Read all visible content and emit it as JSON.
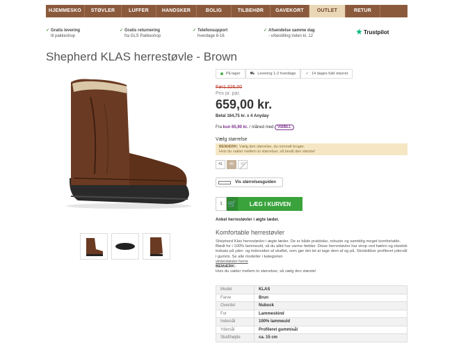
{
  "nav": [
    "HJEMMESKO",
    "STØVLER",
    "LUFFER",
    "HANDSKER",
    "BOLIG",
    "TILBEHØR",
    "GAVEKORT",
    "OUTLET",
    "RETUR"
  ],
  "nav_active": "OUTLET",
  "usps": [
    {
      "title": "Gratis levering",
      "sub": "til pakkeshop"
    },
    {
      "title": "Gratis returnering",
      "sub": "fra GLS Pakkeshop"
    },
    {
      "title": "Telefonsupport",
      "sub": "hverdage 8-16"
    },
    {
      "title": "Afsendelse samme dag",
      "sub": "- v/bestilling inden kl. 12"
    }
  ],
  "trustpilot": "Trustpilot",
  "product": {
    "title": "Shepherd KLAS herrestøvle - Brown",
    "badges": [
      "På lager",
      "Levering 1-2 hverdage",
      "14 dages fuld returret"
    ],
    "old_price": "Før1.325,00",
    "per_pair": "Pris pr. par.",
    "price": "659,00 kr.",
    "anyday_text": "Betal 164,75 kr. x 4",
    "anyday_brand": "Anyday",
    "viabill_pre": "Fra",
    "viabill_amount": "kun 65,90 kr.",
    "viabill_post": "/ måned med",
    "viabill_brand": "VIABILL",
    "choose_size": "Vælg størrelse",
    "note_title": "BEMÆRK:",
    "note_text": "Vælg den størrelse, du normalt bruger.",
    "note_text2": "Hvis du vakler mellem to størrelser, så bestil den største!",
    "sizes": [
      {
        "label": "41",
        "state": "normal"
      },
      {
        "label": "42",
        "state": "selected"
      },
      {
        "label": "43",
        "state": "unavailable"
      }
    ],
    "size_guide": "Vis størrelsesguiden",
    "qty": "1",
    "cart_label": "LÆG I KURVEN",
    "ankel": "Ankel herrestøvler i ægte læder.",
    "sub_title": "Komfortable herrestøvler",
    "description": "Shepherd Klas herrestøvler i ægte læder. De er både praktiske, robuste og samtidig meget komfortable. Blødt for i 100% lammeuld, så du altid har varme fødder. Disse herrestøvler har strop ved hælen og elastisk indsats på yder- og indersiden af skaftet, som gør det let at tage dem af og på. Skridsikker profileret ydersål i gummi. Se alle modeller i kategorien",
    "desc_link": "vinterstøvler herre",
    "desc_note_title": "BEMÆRK:",
    "desc_note": "Hvis du vakler mellem to størrelser, så vælg den største!",
    "specs": [
      [
        "Model",
        "KLAS"
      ],
      [
        "Farve",
        "Brun"
      ],
      [
        "Overdel",
        "Nubuck"
      ],
      [
        "For",
        "Lammeskind"
      ],
      [
        "Indersål",
        "100% lammeuld"
      ],
      [
        "Ydersål",
        "Profileret gummisål"
      ],
      [
        "Skafthøjde",
        "ca. 15 cm"
      ]
    ]
  }
}
